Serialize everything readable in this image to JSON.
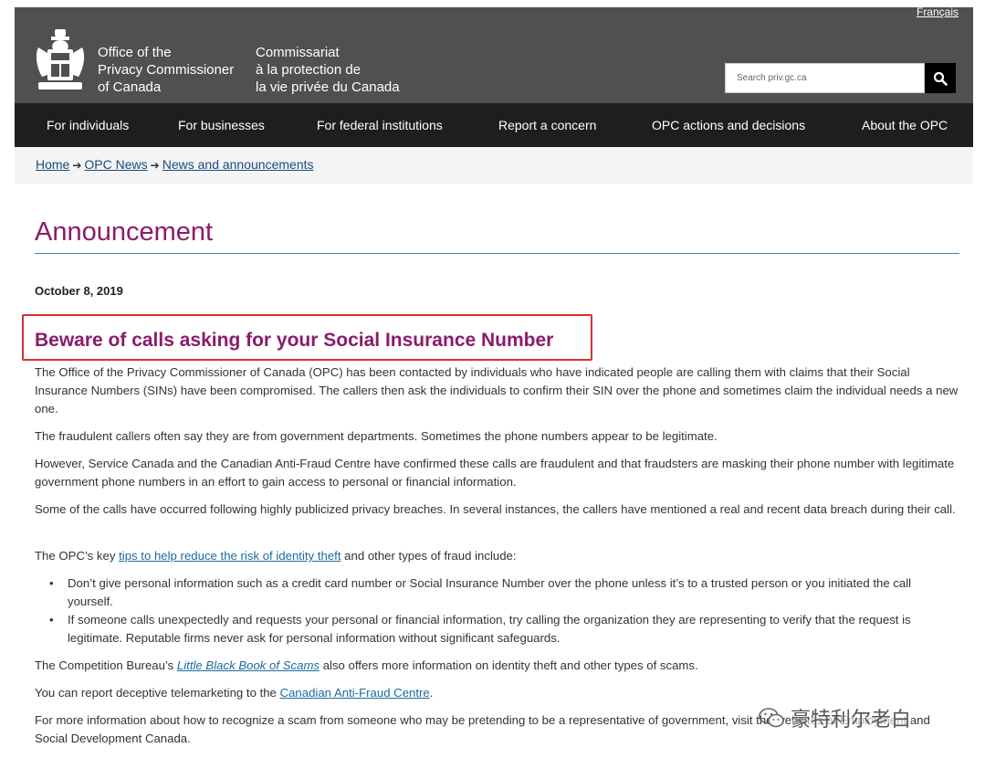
{
  "header": {
    "lang_link": "Français",
    "org_en": [
      "Office of the",
      "Privacy Commissioner",
      "of Canada"
    ],
    "org_fr": [
      "Commissariat",
      "à la protection de",
      "la vie privée du Canada"
    ],
    "search_placeholder": "Search priv.gc.ca"
  },
  "nav": {
    "items": [
      "For individuals",
      "For businesses",
      "For federal institutions",
      "Report a concern",
      "OPC actions and decisions",
      "About the OPC"
    ]
  },
  "breadcrumb": [
    "Home",
    "OPC News",
    "News and announcements"
  ],
  "main": {
    "title": "Announcement",
    "date": "October 8, 2019",
    "headline": "Beware of calls asking for your Social Insurance Number",
    "p1": "The Office of the Privacy Commissioner of Canada (OPC) has been contacted by individuals who have indicated people are calling them with claims that their Social Insurance Numbers (SINs) have been compromised. The callers then ask the individuals to confirm their SIN over the phone and sometimes claim the individual needs a new one.",
    "p2": "The fraudulent callers often say they are from government departments. Sometimes the phone numbers appear to be legitimate.",
    "p3": "However, Service Canada and the Canadian Anti-Fraud Centre have confirmed these calls are fraudulent and that fraudsters are masking their phone number with legitimate government phone numbers in an effort to gain access to personal or financial information.",
    "p4": "Some of the calls have occurred following highly publicized privacy breaches. In several instances, the callers have mentioned a real and recent data breach during their call.",
    "p5_before": "The OPC’s key ",
    "p5_link": "tips to help reduce the risk of identity theft",
    "p5_after": " and other types of fraud include:",
    "bullets": [
      "Don’t give personal information such as a credit card number or Social Insurance Number over the phone unless it’s to a trusted person or you initiated the call yourself.",
      "If someone calls unexpectedly and requests your personal or financial information, try calling the organization they are representing to verify that the request is legitimate. Reputable firms never ask for personal information without significant safeguards."
    ],
    "p6_before": "The Competition Bureau’s ",
    "p6_link": "Little Black Book of Scams",
    "p6_after": " also offers more information on identity theft and other types of scams.",
    "p7_before": "You can report deceptive telemarketing to the ",
    "p7_link": "Canadian Anti-Fraud Centre",
    "p7_after": ".",
    "p8": "For more information about how to recognize a scam from someone who may be pretending to be a representative of government, visit the websites of Employment and Social Development Canada."
  },
  "watermark": "豪特利尔老白",
  "colors": {
    "accent": "#8a1c6a",
    "header": "#505050",
    "nav": "#1e1e1e",
    "highlight": "#d6312f",
    "link": "#1a6aa3"
  }
}
